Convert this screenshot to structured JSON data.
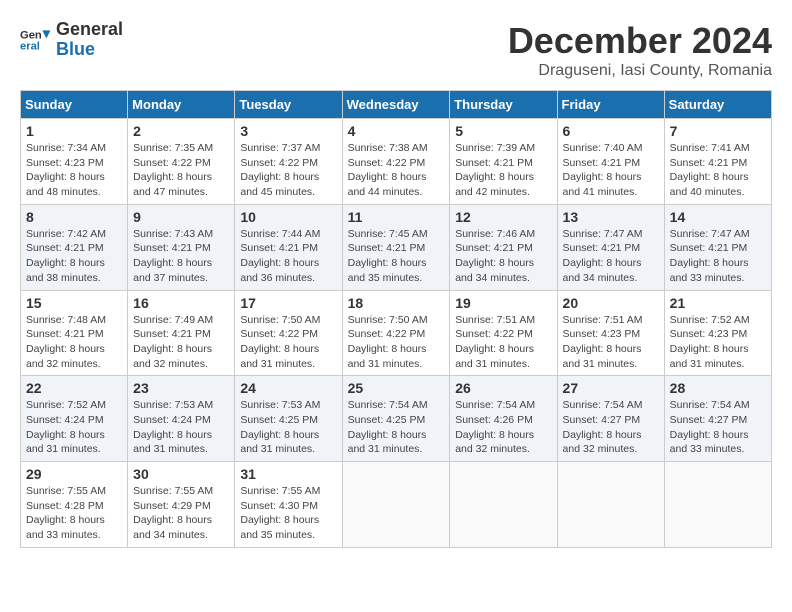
{
  "logo": {
    "text_general": "General",
    "text_blue": "Blue"
  },
  "header": {
    "month": "December 2024",
    "location": "Draguseni, Iasi County, Romania"
  },
  "weekdays": [
    "Sunday",
    "Monday",
    "Tuesday",
    "Wednesday",
    "Thursday",
    "Friday",
    "Saturday"
  ],
  "weeks": [
    [
      {
        "day": "1",
        "sunrise": "7:34 AM",
        "sunset": "4:23 PM",
        "daylight": "8 hours and 48 minutes."
      },
      {
        "day": "2",
        "sunrise": "7:35 AM",
        "sunset": "4:22 PM",
        "daylight": "8 hours and 47 minutes."
      },
      {
        "day": "3",
        "sunrise": "7:37 AM",
        "sunset": "4:22 PM",
        "daylight": "8 hours and 45 minutes."
      },
      {
        "day": "4",
        "sunrise": "7:38 AM",
        "sunset": "4:22 PM",
        "daylight": "8 hours and 44 minutes."
      },
      {
        "day": "5",
        "sunrise": "7:39 AM",
        "sunset": "4:21 PM",
        "daylight": "8 hours and 42 minutes."
      },
      {
        "day": "6",
        "sunrise": "7:40 AM",
        "sunset": "4:21 PM",
        "daylight": "8 hours and 41 minutes."
      },
      {
        "day": "7",
        "sunrise": "7:41 AM",
        "sunset": "4:21 PM",
        "daylight": "8 hours and 40 minutes."
      }
    ],
    [
      {
        "day": "8",
        "sunrise": "7:42 AM",
        "sunset": "4:21 PM",
        "daylight": "8 hours and 38 minutes."
      },
      {
        "day": "9",
        "sunrise": "7:43 AM",
        "sunset": "4:21 PM",
        "daylight": "8 hours and 37 minutes."
      },
      {
        "day": "10",
        "sunrise": "7:44 AM",
        "sunset": "4:21 PM",
        "daylight": "8 hours and 36 minutes."
      },
      {
        "day": "11",
        "sunrise": "7:45 AM",
        "sunset": "4:21 PM",
        "daylight": "8 hours and 35 minutes."
      },
      {
        "day": "12",
        "sunrise": "7:46 AM",
        "sunset": "4:21 PM",
        "daylight": "8 hours and 34 minutes."
      },
      {
        "day": "13",
        "sunrise": "7:47 AM",
        "sunset": "4:21 PM",
        "daylight": "8 hours and 34 minutes."
      },
      {
        "day": "14",
        "sunrise": "7:47 AM",
        "sunset": "4:21 PM",
        "daylight": "8 hours and 33 minutes."
      }
    ],
    [
      {
        "day": "15",
        "sunrise": "7:48 AM",
        "sunset": "4:21 PM",
        "daylight": "8 hours and 32 minutes."
      },
      {
        "day": "16",
        "sunrise": "7:49 AM",
        "sunset": "4:21 PM",
        "daylight": "8 hours and 32 minutes."
      },
      {
        "day": "17",
        "sunrise": "7:50 AM",
        "sunset": "4:22 PM",
        "daylight": "8 hours and 31 minutes."
      },
      {
        "day": "18",
        "sunrise": "7:50 AM",
        "sunset": "4:22 PM",
        "daylight": "8 hours and 31 minutes."
      },
      {
        "day": "19",
        "sunrise": "7:51 AM",
        "sunset": "4:22 PM",
        "daylight": "8 hours and 31 minutes."
      },
      {
        "day": "20",
        "sunrise": "7:51 AM",
        "sunset": "4:23 PM",
        "daylight": "8 hours and 31 minutes."
      },
      {
        "day": "21",
        "sunrise": "7:52 AM",
        "sunset": "4:23 PM",
        "daylight": "8 hours and 31 minutes."
      }
    ],
    [
      {
        "day": "22",
        "sunrise": "7:52 AM",
        "sunset": "4:24 PM",
        "daylight": "8 hours and 31 minutes."
      },
      {
        "day": "23",
        "sunrise": "7:53 AM",
        "sunset": "4:24 PM",
        "daylight": "8 hours and 31 minutes."
      },
      {
        "day": "24",
        "sunrise": "7:53 AM",
        "sunset": "4:25 PM",
        "daylight": "8 hours and 31 minutes."
      },
      {
        "day": "25",
        "sunrise": "7:54 AM",
        "sunset": "4:25 PM",
        "daylight": "8 hours and 31 minutes."
      },
      {
        "day": "26",
        "sunrise": "7:54 AM",
        "sunset": "4:26 PM",
        "daylight": "8 hours and 32 minutes."
      },
      {
        "day": "27",
        "sunrise": "7:54 AM",
        "sunset": "4:27 PM",
        "daylight": "8 hours and 32 minutes."
      },
      {
        "day": "28",
        "sunrise": "7:54 AM",
        "sunset": "4:27 PM",
        "daylight": "8 hours and 33 minutes."
      }
    ],
    [
      {
        "day": "29",
        "sunrise": "7:55 AM",
        "sunset": "4:28 PM",
        "daylight": "8 hours and 33 minutes."
      },
      {
        "day": "30",
        "sunrise": "7:55 AM",
        "sunset": "4:29 PM",
        "daylight": "8 hours and 34 minutes."
      },
      {
        "day": "31",
        "sunrise": "7:55 AM",
        "sunset": "4:30 PM",
        "daylight": "8 hours and 35 minutes."
      },
      null,
      null,
      null,
      null
    ]
  ],
  "labels": {
    "sunrise": "Sunrise:",
    "sunset": "Sunset:",
    "daylight": "Daylight:"
  }
}
